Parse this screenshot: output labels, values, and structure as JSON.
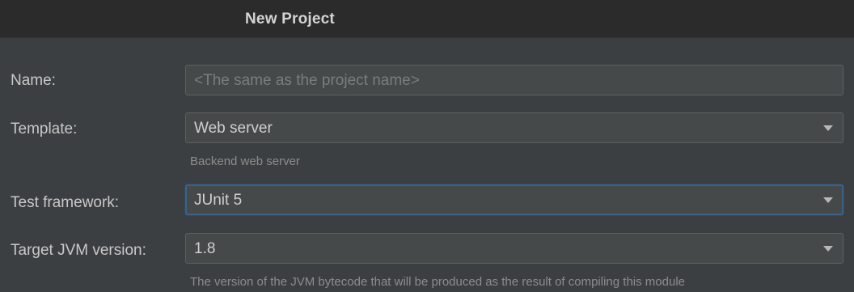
{
  "dialog": {
    "title": "New Project"
  },
  "form": {
    "name": {
      "label": "Name:",
      "placeholder": "<The same as the project name>"
    },
    "template": {
      "label": "Template:",
      "value": "Web server",
      "hint": "Backend web server"
    },
    "test_framework": {
      "label": "Test framework:",
      "value": "JUnit 5"
    },
    "target_jvm": {
      "label": "Target JVM version:",
      "value": "1.8",
      "hint": "The version of the JVM bytecode that will be produced as the result of compiling this module"
    }
  },
  "icons": {
    "dropdown": "chevron-down-icon"
  },
  "colors": {
    "background": "#3c3f41",
    "titlebar": "#2b2b2b",
    "focus_border": "#3d6185"
  }
}
